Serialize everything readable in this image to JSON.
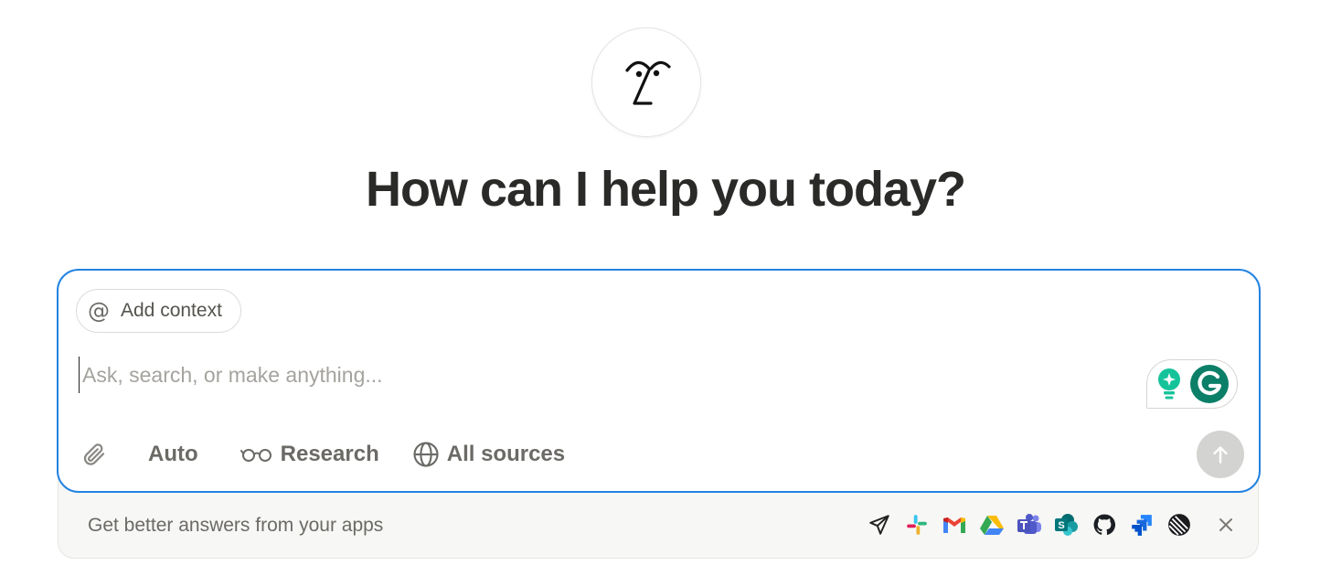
{
  "heading": "How can I help you today?",
  "prompt": {
    "add_context_label": "Add context",
    "placeholder": "Ask, search, or make anything..."
  },
  "toolbar": {
    "auto_label": "Auto",
    "research_label": "Research",
    "sources_label": "All sources"
  },
  "apps_banner": {
    "text": "Get better answers from your apps",
    "icons": [
      "send-icon",
      "slack-icon",
      "gmail-icon",
      "google-drive-icon",
      "teams-icon",
      "sharepoint-icon",
      "github-icon",
      "jira-icon",
      "linear-icon"
    ]
  },
  "colors": {
    "focus_border": "#2383e2",
    "grammarly_green": "#15c39a",
    "grammarly_dark": "#0b7f68",
    "send_button_disabled": "#d3d3d1"
  }
}
